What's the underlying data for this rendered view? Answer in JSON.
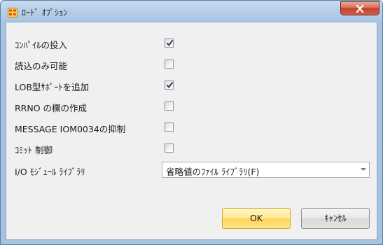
{
  "window": {
    "title": "ﾛｰﾄﾞ ｵﾌﾟｼｮﾝ"
  },
  "options": [
    {
      "label": "ｺﾝﾊﾟｲﾙの投入",
      "checked": true
    },
    {
      "label": "読込のみ可能",
      "checked": false
    },
    {
      "label": "LOB型ｻﾎﾟｰﾄを追加",
      "checked": true
    },
    {
      "label": "RRNO の欄の作成",
      "checked": false
    },
    {
      "label": "MESSAGE IOM0034の抑制",
      "checked": false
    },
    {
      "label": "ｺﾐｯﾄ 制御",
      "checked": false
    }
  ],
  "io_module": {
    "label": "I/O ﾓｼﾞｭｰﾙ ﾗｲﾌﾞﾗﾘ",
    "selected": "省略値のﾌｧｲﾙ ﾗｲﾌﾞﾗﾘ(F)"
  },
  "buttons": {
    "ok": "OK",
    "cancel": "ｷｬﾝｾﾙ"
  },
  "colors": {
    "titlebar": "#b7cfe9",
    "client_bg": "#f0f0f0",
    "ok_button": "#ffe792",
    "close_button": "#c2402a"
  }
}
